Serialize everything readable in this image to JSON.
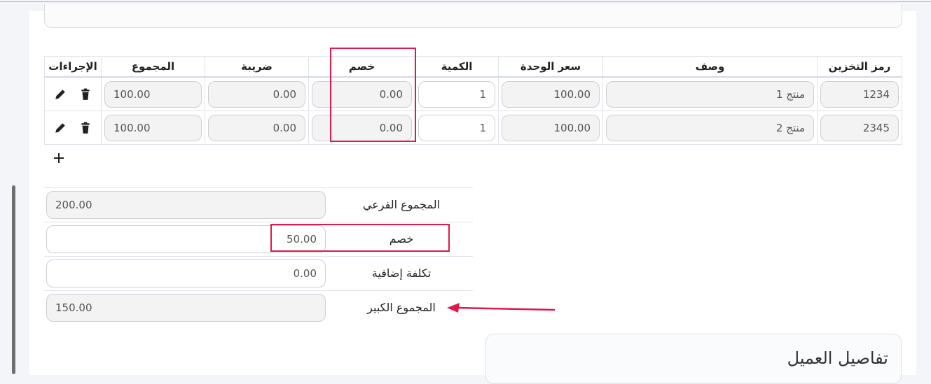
{
  "table": {
    "headers": {
      "sku": "رمز التخزين",
      "description": "وصف",
      "unit_price": "سعر الوحدة",
      "quantity": "الكمية",
      "discount": "خصم",
      "tax": "ضريبة",
      "total": "المجموع",
      "actions": "الإجراءات"
    },
    "rows": [
      {
        "sku": "1234",
        "description": "منتج 1",
        "unit_price": "100.00",
        "quantity": "1",
        "discount": "0.00",
        "tax": "0.00",
        "total": "100.00"
      },
      {
        "sku": "2345",
        "description": "منتج 2",
        "unit_price": "100.00",
        "quantity": "1",
        "discount": "0.00",
        "tax": "0.00",
        "total": "100.00"
      }
    ]
  },
  "totals": {
    "subtotal": {
      "label": "المجموع الفرعي",
      "value": "200.00"
    },
    "discount": {
      "label": "خصم",
      "value": "50.00"
    },
    "extra_cost": {
      "label": "تكلفة إضافية",
      "value": "0.00"
    },
    "grand_total": {
      "label": "المجموع الكبير",
      "value": "150.00"
    }
  },
  "customer": {
    "title": "تفاصيل العميل"
  },
  "colors": {
    "highlight": "#e0184c",
    "border": "#dfe2ea"
  },
  "icons": [
    "edit-icon",
    "delete-icon",
    "add-icon",
    "annotation-arrow"
  ]
}
